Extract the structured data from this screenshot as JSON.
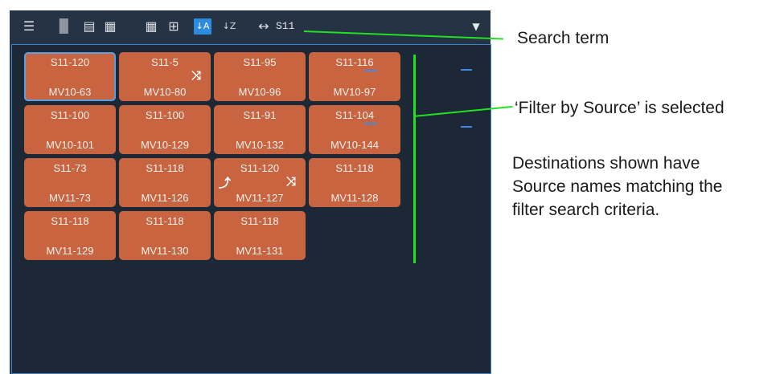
{
  "toolbar": {
    "icons": [
      {
        "name": "list-view-icon",
        "glyph": "☰"
      },
      {
        "name": "page-icon",
        "glyph": "▉"
      },
      {
        "name": "clipboard-icon",
        "glyph": "▤"
      },
      {
        "name": "lock-page-icon",
        "glyph": "▦"
      },
      {
        "name": "large-tiles-icon",
        "glyph": "▦"
      },
      {
        "name": "small-tiles-icon",
        "glyph": "⊞"
      },
      {
        "name": "sort-a-z-icon",
        "glyph": "↓A"
      },
      {
        "name": "sort-z-a-icon",
        "glyph": "↓Z"
      },
      {
        "name": "width-icon",
        "glyph": "↔"
      }
    ],
    "search_term": "S11",
    "filter_glyph": "▼"
  },
  "tiles": [
    {
      "source": "S11-120",
      "destination": "MV10-63",
      "selected": true
    },
    {
      "source": "S11-5",
      "destination": "MV10-80",
      "route_icon": "⤨"
    },
    {
      "source": "S11-95",
      "destination": "MV10-96"
    },
    {
      "source": "S11-116",
      "destination": "MV10-97",
      "underlined": true
    },
    {
      "source": "S11-100",
      "destination": "MV10-101"
    },
    {
      "source": "S11-100",
      "destination": "MV10-129"
    },
    {
      "source": "S11-91",
      "destination": "MV10-132"
    },
    {
      "source": "S11-104",
      "destination": "MV10-144",
      "underlined": true
    },
    {
      "source": "S11-73",
      "destination": "MV11-73"
    },
    {
      "source": "S11-118",
      "destination": "MV11-126"
    },
    {
      "source": "S11-120",
      "destination": "MV11-127",
      "route_icon": "⤨",
      "left_icon": "⤴"
    },
    {
      "source": "S11-118",
      "destination": "MV11-128"
    },
    {
      "source": "S11-118",
      "destination": "MV11-129"
    },
    {
      "source": "S11-118",
      "destination": "MV11-130"
    },
    {
      "source": "S11-118",
      "destination": "MV11-131"
    }
  ],
  "callouts": {
    "search_term": "Search term",
    "filter_selected": "‘Filter by Source’ is selected",
    "destinations_line1": "Destinations shown have",
    "destinations_line2": "Source names matching the",
    "destinations_line3": "filter search criteria."
  },
  "colors": {
    "tile": "#c8643f",
    "panel": "#263345",
    "grid_bg": "#1d2836",
    "accent": "#2d8be0",
    "callout_line": "#22e022"
  }
}
